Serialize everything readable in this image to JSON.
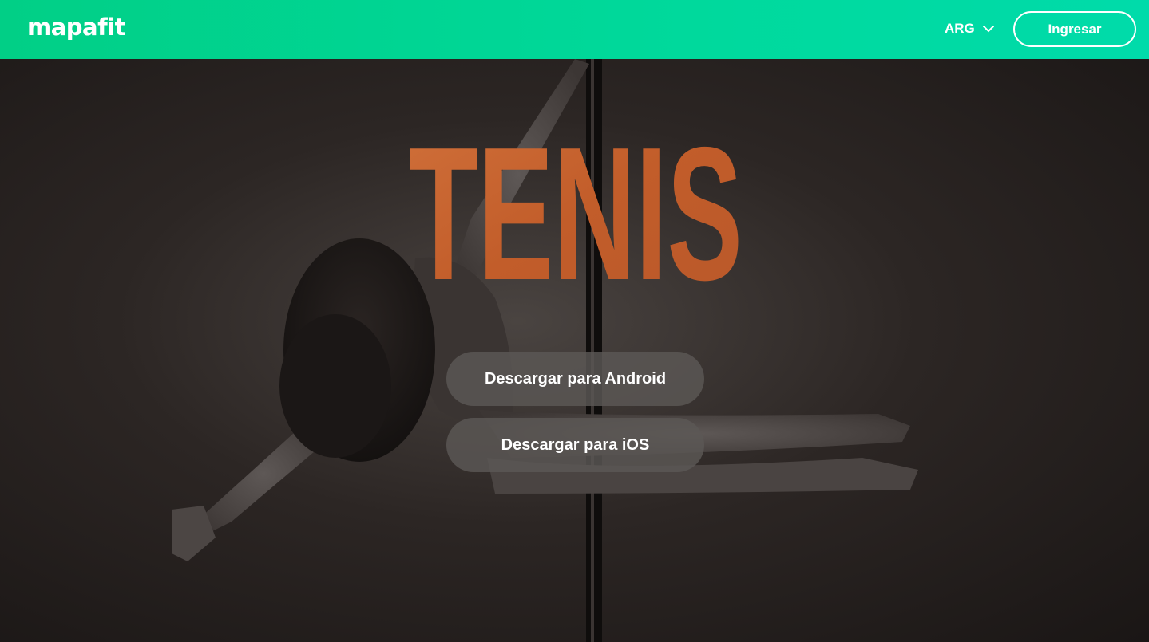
{
  "header": {
    "logo_text": "mapafit",
    "country_selector": "ARG",
    "login_label": "Ingresar"
  },
  "hero": {
    "title": "TENIS",
    "android_button": "Descargar para Android",
    "ios_button": "Descargar para iOS"
  },
  "colors": {
    "header_gradient_start": "#01cf86",
    "header_gradient_end": "#00dbaa",
    "title_orange": "#c9662f",
    "button_bg": "#5c5856"
  },
  "icons": {
    "country_dropdown": "chevron-down-icon"
  }
}
